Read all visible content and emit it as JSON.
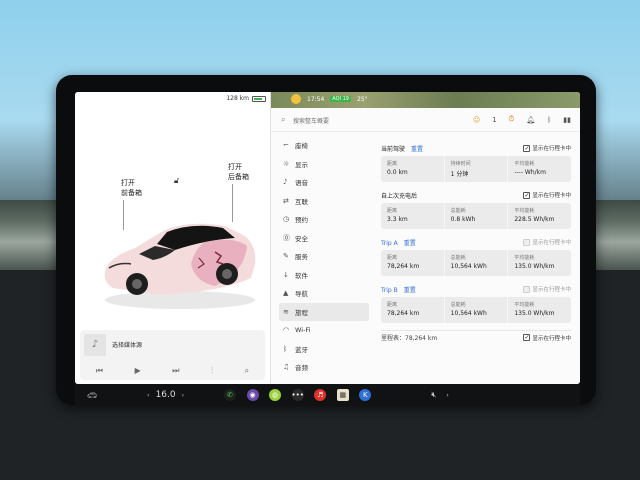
{
  "left": {
    "range": "128 km",
    "front_trunk_action": "打开",
    "front_trunk_label": "前备箱",
    "rear_trunk_action": "打开",
    "rear_trunk_label": "后备箱",
    "media_title": "选择媒体源"
  },
  "topbar": {
    "time": "17:54",
    "temp": "25°",
    "badge": "AQI 19",
    "notifications": "1"
  },
  "search": {
    "placeholder": "搜索整车概要"
  },
  "menu": [
    {
      "icon": "car-icon",
      "glyph": "⌐",
      "label": "座椅"
    },
    {
      "icon": "display-icon",
      "glyph": "☼",
      "label": "显示"
    },
    {
      "icon": "mic-icon",
      "glyph": "♪",
      "label": "语音"
    },
    {
      "icon": "connect-icon",
      "glyph": "⇄",
      "label": "互联"
    },
    {
      "icon": "clock-icon",
      "glyph": "◷",
      "label": "预约"
    },
    {
      "icon": "safety-icon",
      "glyph": "⓪",
      "label": "安全"
    },
    {
      "icon": "wrench-icon",
      "glyph": "✎",
      "label": "服务"
    },
    {
      "icon": "download-icon",
      "glyph": "↓",
      "label": "软件"
    },
    {
      "icon": "nav-icon",
      "glyph": "▲",
      "label": "导航"
    },
    {
      "icon": "trip-icon",
      "glyph": "≋",
      "label": "旅程"
    },
    {
      "icon": "wifi-icon",
      "glyph": "◠",
      "label": "Wi-Fi"
    },
    {
      "icon": "bluetooth-icon",
      "glyph": "ᛒ",
      "label": "蓝牙"
    },
    {
      "icon": "music-icon",
      "glyph": "♫",
      "label": "音频"
    }
  ],
  "sections": [
    {
      "title": "当前驾驶",
      "reset": "重置",
      "blue": false,
      "checkbox": "显示在行程卡中",
      "checked": true,
      "stats": [
        {
          "label": "距离",
          "value": "0.0 km"
        },
        {
          "label": "持续时间",
          "value": "1 分钟"
        },
        {
          "label": "平均能耗",
          "value": "---- Wh/km"
        }
      ]
    },
    {
      "title": "自上次充电后",
      "reset": "",
      "blue": false,
      "checkbox": "显示在行程卡中",
      "checked": true,
      "stats": [
        {
          "label": "距离",
          "value": "3.3 km"
        },
        {
          "label": "总能耗",
          "value": "0.8 kWh"
        },
        {
          "label": "平均能耗",
          "value": "228.5 Wh/km"
        }
      ]
    },
    {
      "title": "Trip A",
      "reset": "重置",
      "blue": true,
      "checkbox": "显示在行程卡中",
      "checked": false,
      "stats": [
        {
          "label": "距离",
          "value": "78,264 km"
        },
        {
          "label": "总能耗",
          "value": "10,564 kWh"
        },
        {
          "label": "平均能耗",
          "value": "135.0 Wh/km"
        }
      ]
    },
    {
      "title": "Trip B",
      "reset": "重置",
      "blue": true,
      "checkbox": "显示在行程卡中",
      "checked": false,
      "stats": [
        {
          "label": "距离",
          "value": "78,264 km"
        },
        {
          "label": "总能耗",
          "value": "10,564 kWh"
        },
        {
          "label": "平均能耗",
          "value": "135.0 Wh/km"
        }
      ]
    }
  ],
  "odometer": {
    "label": "里程表：78,264 km",
    "checkbox": "显示在行程卡中"
  },
  "dock": {
    "temp": "16.0"
  }
}
